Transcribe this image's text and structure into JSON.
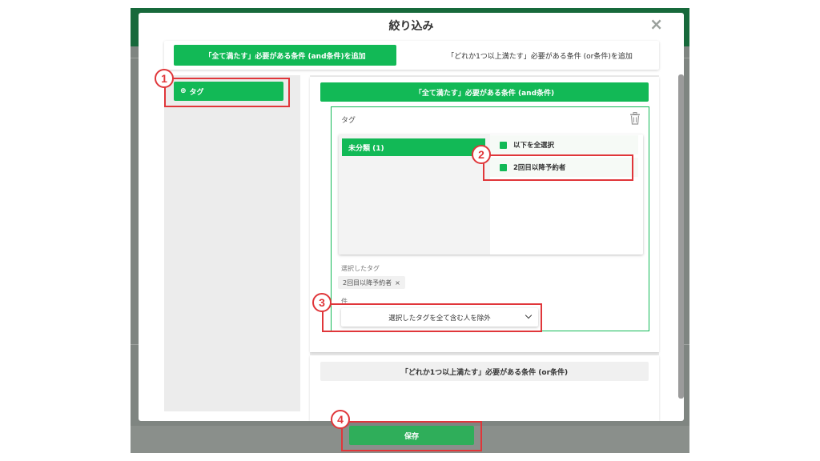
{
  "modal": {
    "title": "絞り込み",
    "close_icon": "×",
    "tabs": {
      "and": "「全て満たす」必要がある条件 (and条件)を追加",
      "or": "「どれか1つ以上満たす」必要がある条件 (or条件)を追加"
    },
    "left_panel": {
      "tag_button_label": "タグ",
      "tag_button_icon": "⊕"
    },
    "and_section": {
      "header": "「全て満たす」必要がある条件 (and条件)",
      "block_label": "タグ",
      "picker": {
        "category": "未分類 (1)",
        "options": [
          "以下を全選択",
          "2回目以降予約者"
        ]
      },
      "selected_tags_label": "選択したタグ",
      "selected_tag_chip": "2回目以降予約者",
      "chip_remove_icon": "×",
      "condition_label": "件",
      "condition_value": "選択したタグを全て含む人を除外"
    },
    "or_section": {
      "header": "「どれか1つ以上満たす」必要がある条件 (or条件)"
    },
    "save_label": "保存"
  },
  "annotations": [
    "1",
    "2",
    "3",
    "4"
  ],
  "colors": {
    "green": "#12b956",
    "annotation_red": "#e0363a"
  }
}
